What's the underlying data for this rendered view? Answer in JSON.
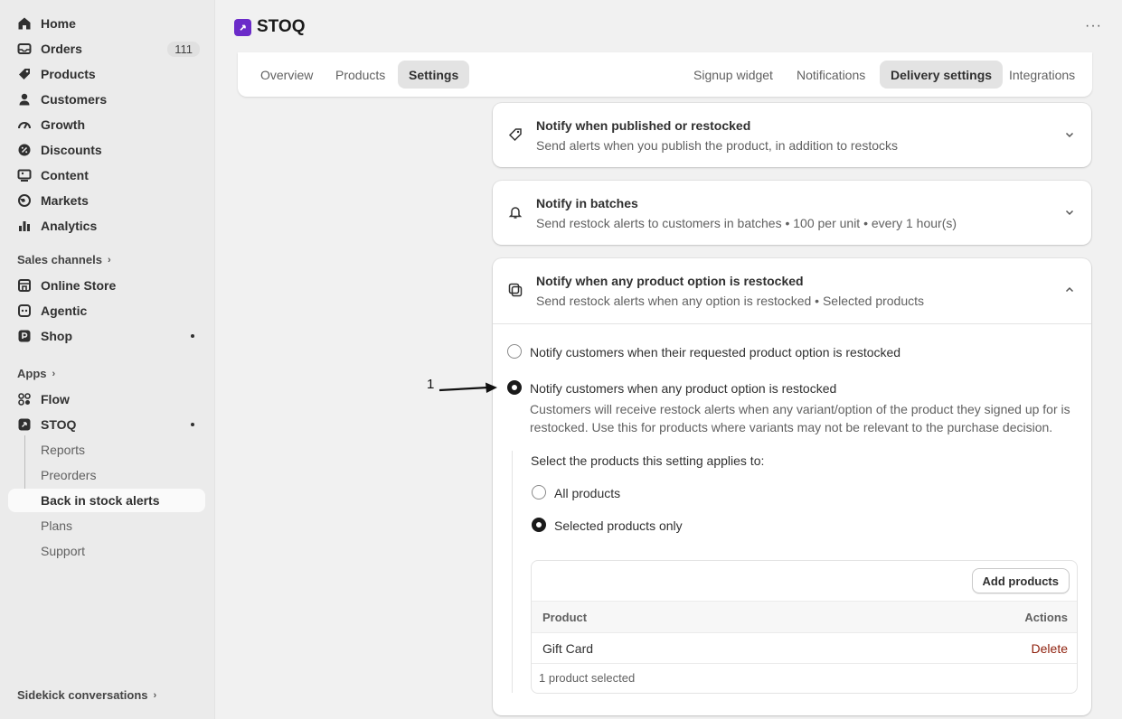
{
  "sidebar": {
    "items": [
      {
        "label": "Home",
        "icon": "home-icon"
      },
      {
        "label": "Orders",
        "icon": "orders-icon",
        "badge": "111"
      },
      {
        "label": "Products",
        "icon": "tag-icon"
      },
      {
        "label": "Customers",
        "icon": "person-icon"
      },
      {
        "label": "Growth",
        "icon": "gauge-icon"
      },
      {
        "label": "Discounts",
        "icon": "discount-icon"
      },
      {
        "label": "Content",
        "icon": "content-icon"
      },
      {
        "label": "Markets",
        "icon": "globe-icon"
      },
      {
        "label": "Analytics",
        "icon": "bar-chart-icon"
      }
    ],
    "sales_channels_label": "Sales channels",
    "channels": [
      {
        "label": "Online Store",
        "icon": "store-icon"
      },
      {
        "label": "Agentic",
        "icon": "agentic-icon"
      },
      {
        "label": "Shop",
        "icon": "shop-icon"
      }
    ],
    "apps_label": "Apps",
    "apps": [
      {
        "label": "Flow",
        "icon": "flow-icon"
      },
      {
        "label": "STOQ",
        "icon": "stoq-icon"
      }
    ],
    "stoq_subitems": [
      "Reports",
      "Preorders",
      "Back in stock alerts",
      "Plans",
      "Support"
    ],
    "sidekick_label": "Sidekick conversations"
  },
  "header": {
    "app_title": "STOQ",
    "more_label": "···"
  },
  "tabs_left": [
    "Overview",
    "Products",
    "Settings"
  ],
  "tabs_right": [
    "Signup widget",
    "Notifications",
    "Delivery settings",
    "Integrations"
  ],
  "cards": [
    {
      "title": "Notify when published or restocked",
      "desc": "Send alerts when you publish the product, in addition to restocks"
    },
    {
      "title": "Notify in batches",
      "desc": "Send restock alerts to customers in batches • 100 per unit • every 1 hour(s)"
    },
    {
      "title": "Notify when any product option is restocked",
      "desc": "Send restock alerts when any option is restocked • Selected products"
    }
  ],
  "options": {
    "requested": "Notify customers when their requested product option is restocked",
    "any": "Notify customers when any product option is restocked",
    "help": "Customers will receive restock alerts when any variant/option of the product they signed up for is restocked. Use this for products where variants may not be relevant to the purchase decision.",
    "applies_label": "Select the products this setting applies to:",
    "all_products": "All products",
    "selected_only": "Selected products only"
  },
  "product_table": {
    "add_button": "Add products",
    "col_product": "Product",
    "col_actions": "Actions",
    "rows": [
      {
        "product": "Gift Card",
        "action": "Delete"
      }
    ],
    "footer": "1 product selected"
  },
  "annotation": {
    "number": "1"
  },
  "colors": {
    "accent": "#6b2bc9",
    "danger": "#8e1f0b"
  }
}
